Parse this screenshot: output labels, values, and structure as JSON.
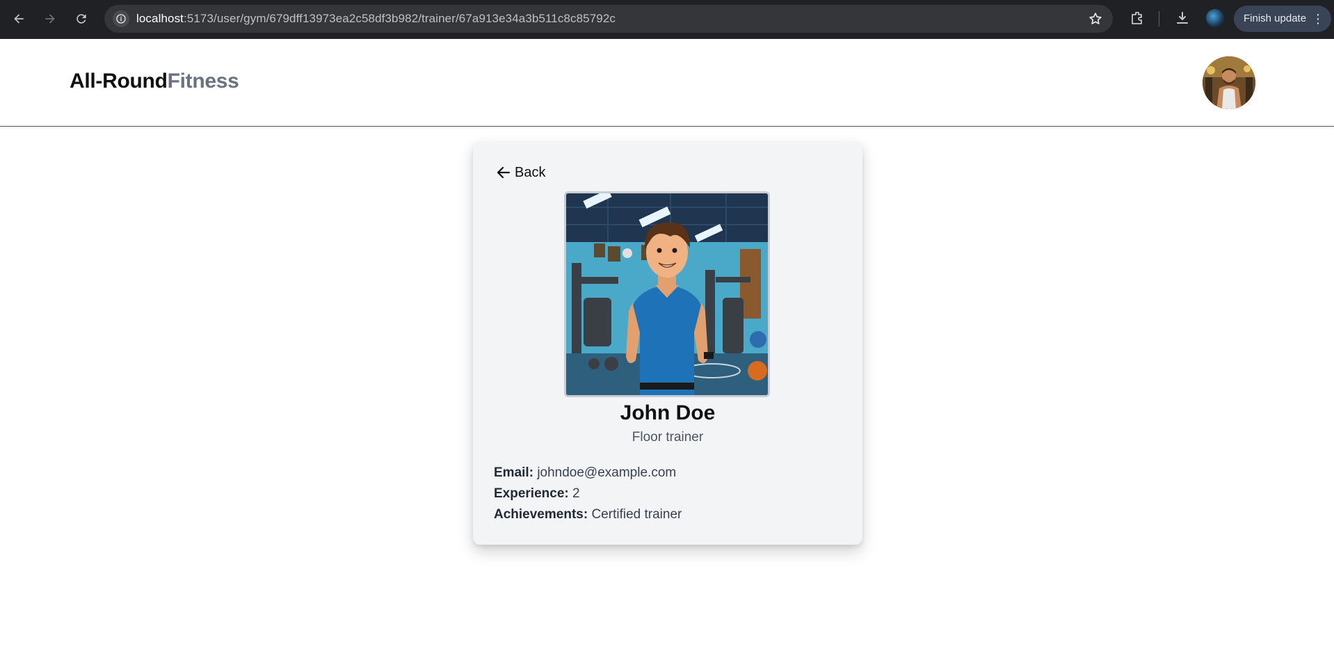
{
  "browser": {
    "url_host": "localhost",
    "url_path": ":5173/user/gym/679dff13973ea2c58df3b982/trainer/67a913e34a3b511c8c85792c",
    "update_button_label": "Finish update",
    "icons": [
      "back-arrow-icon",
      "forward-arrow-icon",
      "reload-icon",
      "site-info-icon",
      "bookmark-star-icon",
      "extensions-icon",
      "download-icon",
      "profile-icon",
      "more-vert-icon"
    ]
  },
  "header": {
    "logo_primary": "All-Round",
    "logo_secondary": "Fitness"
  },
  "trainer": {
    "back_label": "Back",
    "name": "John Doe",
    "role": "Floor trainer",
    "email_label": "Email:",
    "email": "johndoe@example.com",
    "experience_label": "Experience:",
    "experience": "2",
    "achievements_label": "Achievements:",
    "achievements": "Certified trainer"
  },
  "colors": {
    "chrome_bg": "#202124",
    "omnibox_bg": "#35363a",
    "card_bg": "#f3f4f6",
    "logo_dark": "#111111",
    "logo_muted": "#687280",
    "tshirt_blue": "#1e73b8"
  }
}
